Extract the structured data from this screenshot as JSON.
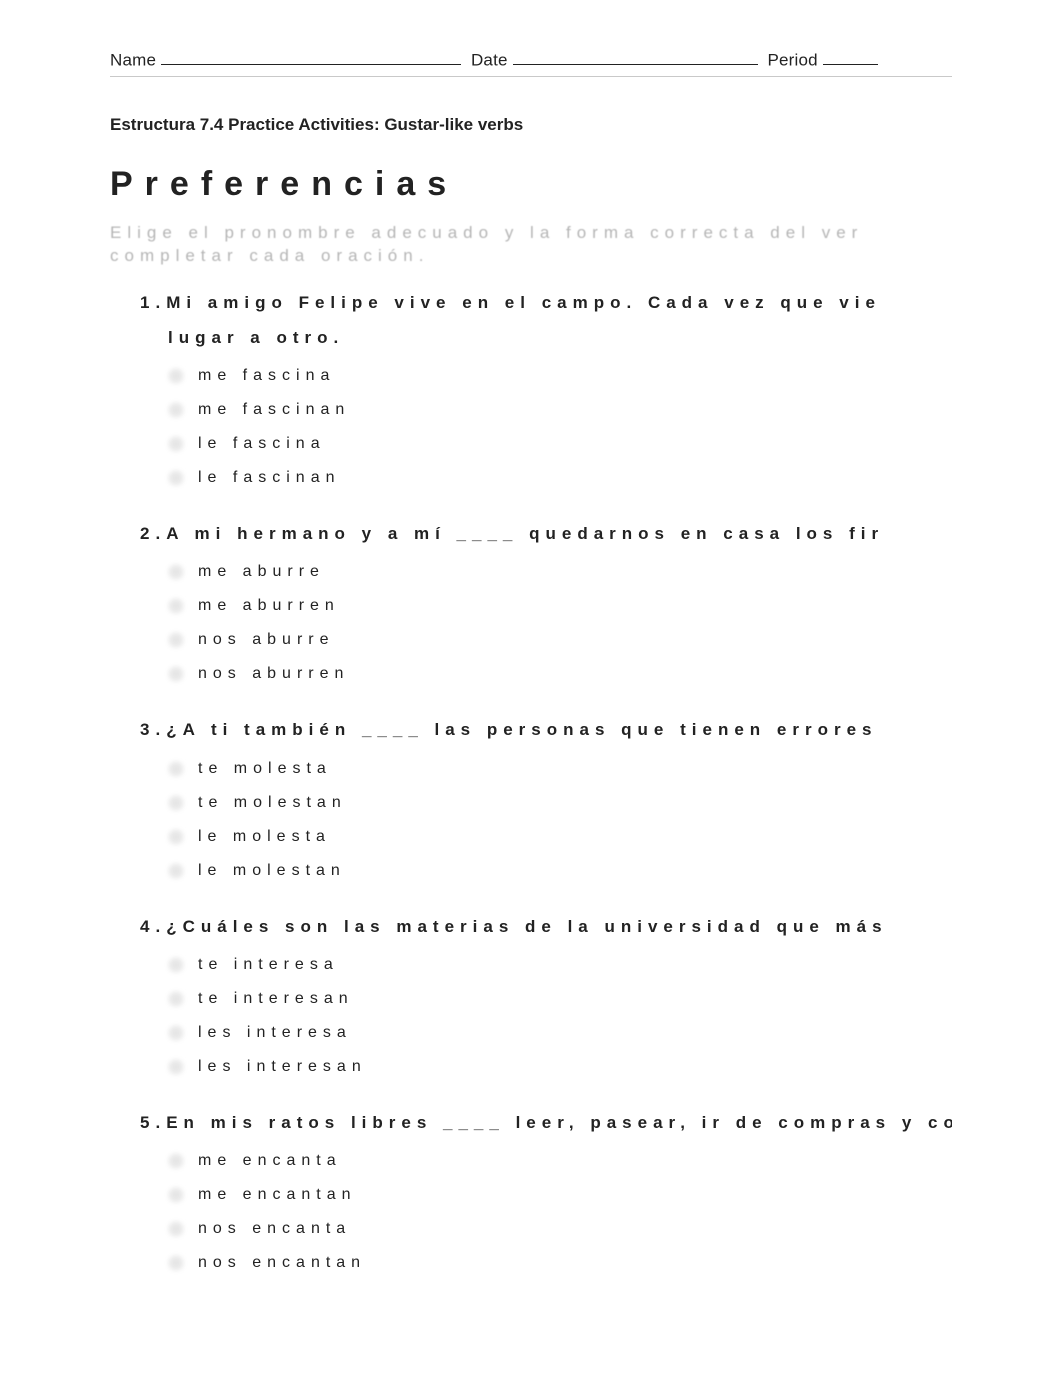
{
  "header": {
    "name_label": "Name",
    "date_label": "Date",
    "period_label": "Period"
  },
  "subheading": "Estructura 7.4 Practice Activities: Gustar-like verbs",
  "title": "Preferencias",
  "instructions": "Elige el pronombre adecuado y la forma correcta del ver completar cada oración.",
  "questions": [
    {
      "num": "1.",
      "text": "Mi amigo Felipe vive en el campo. Cada vez que vie",
      "text2": "lugar a otro.",
      "choices": [
        "me fascina",
        "me fascinan",
        "le fascina",
        "le fascinan"
      ]
    },
    {
      "num": "2.",
      "text": "A mi hermano y a mí ____ quedarnos en casa los fir",
      "choices": [
        "me aburre",
        "me aburren",
        "nos aburre",
        "nos aburren"
      ]
    },
    {
      "num": "3.",
      "text": "¿A ti también ____ las personas que tienen errores",
      "choices": [
        "te molesta",
        "te molestan",
        "le molesta",
        "le molestan"
      ]
    },
    {
      "num": "4.",
      "text": "¿Cuáles son las materias de la universidad que más",
      "choices": [
        "te interesa",
        "te interesan",
        "les interesa",
        "les interesan"
      ]
    },
    {
      "num": "5.",
      "text": "En mis ratos libres ____ leer, pasear, ir de compras y coci",
      "choices": [
        "me encanta",
        "me encantan",
        "nos encanta",
        "nos encantan"
      ]
    }
  ]
}
